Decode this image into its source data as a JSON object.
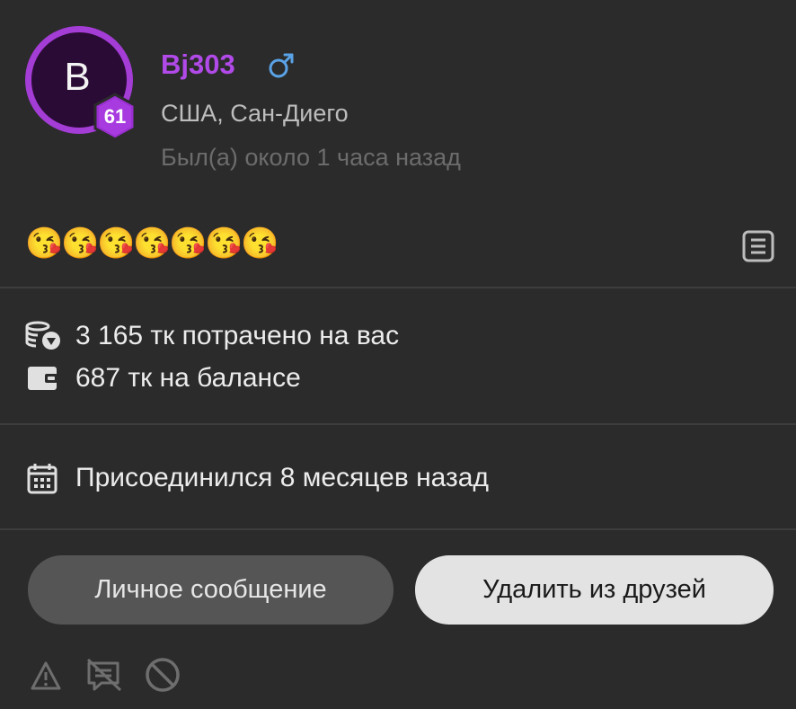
{
  "profile": {
    "avatar_letter": "B",
    "level": "61",
    "username": "Bj303",
    "gender_symbol": "♂",
    "location": "США, Сан-Диего",
    "last_seen": "Был(а) около 1 часа назад"
  },
  "status": {
    "emojis": [
      "😘",
      "😘",
      "😘",
      "😘",
      "😘",
      "😘",
      "😘"
    ]
  },
  "stats": {
    "spent": "3 165 тк потрачено на вас",
    "balance": "687 тк на балансе"
  },
  "joined": "Присоединился 8 месяцев назад",
  "actions": {
    "message_label": "Личное сообщение",
    "remove_friend_label": "Удалить из друзей"
  },
  "icons": {
    "gender": "male-symbol-icon",
    "notes": "notes-icon",
    "coins": "coins-icon",
    "wallet": "wallet-icon",
    "calendar": "calendar-icon",
    "report": "warning-icon",
    "mute_chat": "chat-off-icon",
    "block": "block-icon"
  },
  "colors": {
    "accent": "#b14ae8",
    "avatar_ring": "#a43cd6",
    "gender": "#5aa2e6",
    "background": "#2b2b2b"
  }
}
